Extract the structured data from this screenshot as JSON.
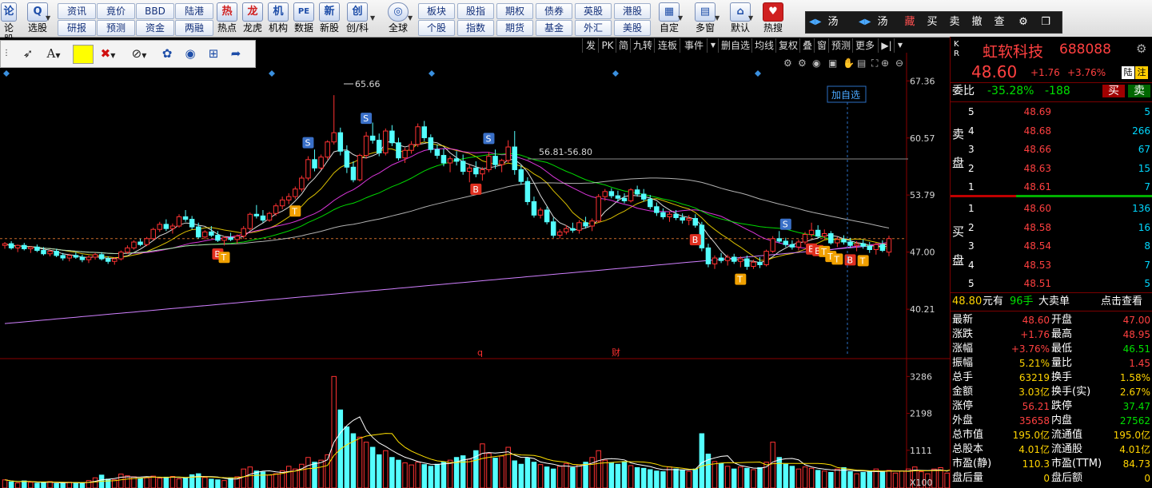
{
  "toolbar": {
    "left_labels": [
      "论股",
      "选股"
    ],
    "grid_buttons": [
      [
        "资讯",
        "竟价",
        "BBD",
        "陆港"
      ],
      [
        "研报",
        "预测",
        "资金",
        "两融"
      ]
    ],
    "icon_buttons": [
      {
        "icon": "热",
        "label": "热点",
        "name": "hotspot"
      },
      {
        "icon": "龙",
        "label": "龙虎",
        "name": "dragon-tiger"
      },
      {
        "icon": "机",
        "label": "机构",
        "name": "institution"
      },
      {
        "icon": "PE",
        "label": "数据",
        "name": "data"
      },
      {
        "icon": "新",
        "label": "新股",
        "name": "new-stock"
      },
      {
        "icon": "创",
        "label": "创/科",
        "name": "gem-star"
      },
      {
        "icon": "◎",
        "label": "全球",
        "name": "global"
      }
    ],
    "grid_buttons2": [
      [
        "板块",
        "股指",
        "期权",
        "债券",
        "英股",
        "港股"
      ],
      [
        "个股",
        "指数",
        "期货",
        "基金",
        "外汇",
        "美股"
      ]
    ],
    "right_icons": [
      {
        "icon": "▦",
        "label": "自定",
        "name": "custom"
      },
      {
        "icon": "▤",
        "label": "多窗",
        "name": "multi-window"
      },
      {
        "icon": "⌂",
        "label": "默认",
        "name": "default"
      },
      {
        "icon": "♥",
        "label": "热搜",
        "name": "hot-search"
      }
    ],
    "trade": {
      "items": [
        "汤",
        "汤",
        "藏",
        "买",
        "卖",
        "撤",
        "查"
      ]
    }
  },
  "chart_tabs": [
    "发",
    "PK",
    "简",
    "九转",
    "连板",
    "事件",
    "删自选",
    "均线",
    "复权",
    "叠",
    "窗",
    "预测",
    "更多"
  ],
  "chart_annotations": {
    "high_label": "65.66",
    "range_label": "56.81-56.80",
    "add_watch": "加自选",
    "marker_q": "q",
    "marker_cai": "财"
  },
  "stock": {
    "name": "虹软科技",
    "code": "688088",
    "price": "48.60",
    "change": "+1.76",
    "change_pct": "+3.76%",
    "tag_lu": "陆",
    "tag_zhu": "注",
    "kr": "K R"
  },
  "weibi": {
    "label": "委比",
    "pct": "-35.28%",
    "diff": "-188",
    "buy_btn": "买",
    "sell_btn": "卖"
  },
  "order_book": {
    "sell_label": [
      "卖",
      "盘"
    ],
    "buy_label": [
      "买",
      "盘"
    ],
    "asks": [
      {
        "level": "5",
        "price": "48.69",
        "vol": "5"
      },
      {
        "level": "4",
        "price": "48.68",
        "vol": "266"
      },
      {
        "level": "3",
        "price": "48.66",
        "vol": "67"
      },
      {
        "level": "2",
        "price": "48.63",
        "vol": "15"
      },
      {
        "level": "1",
        "price": "48.61",
        "vol": "7"
      }
    ],
    "bids": [
      {
        "level": "1",
        "price": "48.60",
        "vol": "136"
      },
      {
        "level": "2",
        "price": "48.58",
        "vol": "16"
      },
      {
        "level": "3",
        "price": "48.54",
        "vol": "8"
      },
      {
        "level": "4",
        "price": "48.53",
        "vol": "7"
      },
      {
        "level": "5",
        "price": "48.51",
        "vol": "5"
      }
    ]
  },
  "big_order": {
    "price": "48.80",
    "unit": "元有",
    "count": "96手",
    "label": "大卖单",
    "link": "点击查看"
  },
  "stats": [
    {
      "l1": "最新",
      "v1": "48.60",
      "c1": "red",
      "l2": "开盘",
      "v2": "47.00",
      "c2": "red"
    },
    {
      "l1": "涨跌",
      "v1": "+1.76",
      "c1": "red",
      "l2": "最高",
      "v2": "48.95",
      "c2": "red"
    },
    {
      "l1": "涨幅",
      "v1": "+3.76%",
      "c1": "red",
      "l2": "最低",
      "v2": "46.51",
      "c2": "green"
    },
    {
      "l1": "振幅",
      "v1": "5.21%",
      "c1": "yellow",
      "l2": "量比",
      "v2": "1.45",
      "c2": "red"
    },
    {
      "l1": "总手",
      "v1": "63219",
      "c1": "yellow",
      "l2": "换手",
      "v2": "1.58%",
      "c2": "yellow"
    },
    {
      "l1": "金额",
      "v1": "3.03亿",
      "c1": "yellow",
      "l2": "换手(实)",
      "v2": "2.67%",
      "c2": "yellow"
    },
    {
      "l1": "涨停",
      "v1": "56.21",
      "c1": "red",
      "l2": "跌停",
      "v2": "37.47",
      "c2": "green"
    },
    {
      "l1": "外盘",
      "v1": "35658",
      "c1": "red",
      "l2": "内盘",
      "v2": "27562",
      "c2": "green"
    },
    {
      "l1": "总市值",
      "v1": "195.0亿",
      "c1": "yellow",
      "l2": "流通值",
      "v2": "195.0亿",
      "c2": "yellow"
    },
    {
      "l1": "总股本",
      "v1": "4.01亿",
      "c1": "yellow",
      "l2": "流通股",
      "v2": "4.01亿",
      "c2": "yellow"
    },
    {
      "l1": "市盈(静)",
      "v1": "110.3",
      "c1": "yellow",
      "l2": "市盈(TTM)",
      "v2": "84.73",
      "c2": "yellow"
    },
    {
      "l1": "盘后量",
      "v1": "0",
      "c1": "yellow",
      "l2": "盘后额",
      "v2": "0",
      "c2": "yellow"
    }
  ],
  "chart_data": {
    "type": "candlestick",
    "price_ticks": [
      67.36,
      60.57,
      53.79,
      47.0,
      40.21
    ],
    "price_range": [
      35.0,
      69.0
    ],
    "volume_ticks": [
      3286,
      2198,
      1111
    ],
    "volume_range": [
      0,
      3600
    ],
    "volume_unit": "X100",
    "reference_price": 48.6,
    "candles": [
      [
        47.8,
        48.2,
        47.4,
        48.0
      ],
      [
        48.0,
        48.3,
        47.3,
        47.5
      ],
      [
        47.5,
        47.9,
        47.0,
        47.8
      ],
      [
        47.8,
        48.1,
        47.2,
        47.4
      ],
      [
        47.4,
        47.7,
        46.9,
        47.6
      ],
      [
        47.6,
        47.9,
        47.0,
        47.2
      ],
      [
        47.2,
        47.6,
        46.6,
        46.8
      ],
      [
        46.8,
        47.3,
        46.5,
        47.1
      ],
      [
        47.1,
        47.4,
        46.4,
        46.6
      ],
      [
        46.6,
        46.9,
        46.0,
        46.3
      ],
      [
        46.3,
        46.8,
        45.9,
        46.6
      ],
      [
        46.6,
        47.0,
        46.2,
        46.4
      ],
      [
        46.4,
        46.7,
        45.8,
        46.1
      ],
      [
        46.1,
        46.6,
        45.7,
        46.4
      ],
      [
        46.4,
        46.9,
        46.1,
        46.7
      ],
      [
        46.7,
        47.0,
        46.0,
        46.2
      ],
      [
        46.2,
        46.5,
        45.6,
        45.9
      ],
      [
        45.9,
        46.4,
        45.5,
        46.2
      ],
      [
        46.2,
        47.2,
        46.0,
        47.0
      ],
      [
        47.0,
        47.8,
        46.8,
        47.5
      ],
      [
        47.5,
        48.4,
        47.3,
        48.2
      ],
      [
        48.2,
        48.6,
        47.7,
        47.9
      ],
      [
        47.9,
        48.8,
        47.7,
        48.6
      ],
      [
        48.6,
        49.9,
        48.4,
        49.7
      ],
      [
        49.7,
        50.6,
        49.4,
        50.3
      ],
      [
        50.3,
        50.9,
        49.5,
        49.8
      ],
      [
        49.8,
        50.4,
        49.2,
        50.1
      ],
      [
        50.1,
        51.5,
        49.9,
        51.2
      ],
      [
        51.2,
        52.0,
        50.6,
        50.9
      ],
      [
        50.9,
        51.3,
        49.7,
        50.0
      ],
      [
        50.0,
        50.5,
        48.6,
        48.8
      ],
      [
        48.8,
        49.6,
        48.5,
        49.4
      ],
      [
        49.4,
        50.1,
        48.8,
        49.0
      ],
      [
        49.0,
        49.5,
        48.2,
        48.4
      ],
      [
        48.4,
        48.9,
        47.8,
        48.7
      ],
      [
        48.7,
        49.3,
        48.3,
        48.5
      ],
      [
        48.5,
        49.1,
        48.0,
        48.9
      ],
      [
        48.9,
        50.1,
        48.6,
        49.8
      ],
      [
        49.8,
        51.7,
        49.6,
        51.5
      ],
      [
        51.5,
        52.6,
        51.0,
        51.3
      ],
      [
        51.3,
        52.0,
        50.5,
        50.8
      ],
      [
        50.8,
        51.8,
        50.6,
        51.6
      ],
      [
        51.6,
        52.8,
        51.3,
        52.5
      ],
      [
        52.5,
        53.6,
        52.1,
        53.2
      ],
      [
        53.2,
        54.0,
        52.7,
        53.6
      ],
      [
        53.6,
        54.8,
        53.3,
        54.5
      ],
      [
        54.5,
        56.1,
        54.2,
        55.8
      ],
      [
        55.8,
        58.4,
        55.5,
        58.0
      ],
      [
        58.0,
        59.2,
        56.6,
        57.0
      ],
      [
        57.0,
        58.6,
        56.8,
        58.3
      ],
      [
        58.3,
        60.3,
        58.0,
        60.1
      ],
      [
        60.1,
        65.66,
        59.8,
        61.2
      ],
      [
        61.2,
        61.8,
        58.5,
        59.0
      ],
      [
        59.0,
        59.7,
        56.4,
        57.1
      ],
      [
        57.1,
        57.8,
        55.3,
        55.6
      ],
      [
        55.6,
        58.7,
        55.4,
        58.5
      ],
      [
        58.5,
        61.3,
        58.1,
        60.8
      ],
      [
        60.8,
        62.4,
        59.9,
        60.3
      ],
      [
        60.3,
        61.1,
        58.4,
        58.8
      ],
      [
        58.8,
        61.7,
        58.5,
        61.4
      ],
      [
        61.4,
        62.1,
        59.6,
        60.0
      ],
      [
        60.0,
        60.6,
        57.9,
        58.2
      ],
      [
        58.2,
        59.4,
        57.6,
        59.1
      ],
      [
        59.1,
        60.2,
        58.7,
        59.8
      ],
      [
        59.8,
        62.3,
        59.5,
        61.9
      ],
      [
        61.9,
        62.6,
        60.2,
        60.6
      ],
      [
        60.6,
        61.0,
        58.8,
        59.2
      ],
      [
        59.2,
        59.8,
        58.1,
        58.5
      ],
      [
        58.5,
        59.3,
        57.2,
        57.6
      ],
      [
        57.6,
        58.4,
        56.5,
        58.1
      ],
      [
        58.1,
        59.0,
        57.3,
        57.8
      ],
      [
        57.8,
        58.6,
        56.2,
        56.6
      ],
      [
        56.6,
        57.4,
        55.3,
        57.0
      ],
      [
        57.0,
        57.8,
        55.9,
        56.3
      ],
      [
        56.3,
        57.1,
        55.5,
        56.8
      ],
      [
        56.8,
        58.9,
        56.5,
        58.4
      ],
      [
        58.4,
        59.2,
        56.9,
        57.4
      ],
      [
        57.4,
        58.1,
        56.5,
        57.9
      ],
      [
        57.9,
        60.3,
        57.6,
        59.5
      ],
      [
        59.5,
        61.4,
        56.2,
        56.8
      ],
      [
        56.8,
        57.3,
        55.0,
        55.4
      ],
      [
        55.4,
        55.9,
        52.6,
        53.0
      ],
      [
        53.0,
        53.6,
        51.1,
        51.4
      ],
      [
        51.4,
        52.3,
        51.0,
        52.0
      ],
      [
        52.0,
        52.4,
        50.3,
        50.6
      ],
      [
        50.6,
        51.1,
        48.7,
        49.0
      ],
      [
        49.0,
        49.7,
        48.6,
        49.4
      ],
      [
        49.4,
        50.2,
        49.1,
        49.8
      ],
      [
        49.8,
        50.5,
        49.3,
        49.6
      ],
      [
        49.6,
        50.8,
        49.2,
        50.5
      ],
      [
        50.5,
        51.2,
        49.8,
        50.1
      ],
      [
        50.1,
        51.0,
        49.5,
        50.7
      ],
      [
        50.7,
        53.9,
        50.5,
        53.6
      ],
      [
        53.6,
        54.5,
        53.1,
        54.2
      ],
      [
        54.2,
        54.6,
        53.4,
        53.7
      ],
      [
        53.7,
        54.3,
        53.0,
        53.4
      ],
      [
        53.4,
        54.0,
        52.8,
        53.1
      ],
      [
        53.1,
        54.6,
        52.9,
        54.4
      ],
      [
        54.4,
        54.9,
        53.6,
        53.9
      ],
      [
        53.9,
        54.5,
        53.0,
        53.3
      ],
      [
        53.3,
        53.8,
        52.1,
        52.4
      ],
      [
        52.4,
        52.9,
        51.3,
        51.7
      ],
      [
        51.7,
        52.2,
        50.9,
        51.2
      ],
      [
        51.2,
        51.8,
        50.6,
        51.5
      ],
      [
        51.5,
        52.0,
        50.8,
        51.1
      ],
      [
        51.1,
        51.6,
        50.4,
        50.8
      ],
      [
        50.8,
        51.4,
        50.2,
        51.0
      ],
      [
        51.0,
        51.5,
        49.9,
        50.2
      ],
      [
        50.2,
        50.6,
        47.1,
        47.5
      ],
      [
        47.5,
        48.0,
        45.2,
        45.6
      ],
      [
        45.6,
        46.6,
        45.0,
        46.3
      ],
      [
        46.3,
        46.9,
        45.7,
        46.0
      ],
      [
        46.0,
        46.7,
        45.4,
        46.4
      ],
      [
        46.4,
        46.8,
        45.6,
        45.9
      ],
      [
        45.9,
        46.5,
        45.2,
        46.2
      ],
      [
        46.2,
        46.6,
        44.9,
        45.3
      ],
      [
        45.3,
        46.1,
        45.0,
        45.8
      ],
      [
        45.8,
        46.4,
        45.1,
        45.5
      ],
      [
        45.5,
        47.3,
        45.3,
        47.1
      ],
      [
        47.1,
        48.9,
        46.9,
        48.6
      ],
      [
        48.6,
        49.5,
        48.1,
        48.3
      ],
      [
        48.3,
        48.7,
        47.6,
        47.9
      ],
      [
        47.9,
        48.4,
        47.3,
        47.6
      ],
      [
        47.6,
        48.5,
        47.2,
        48.2
      ],
      [
        48.2,
        49.4,
        47.9,
        49.1
      ],
      [
        49.1,
        50.5,
        48.8,
        49.6
      ],
      [
        49.6,
        50.2,
        48.6,
        48.9
      ],
      [
        48.9,
        49.7,
        48.5,
        49.2
      ],
      [
        49.2,
        49.5,
        47.9,
        48.1
      ],
      [
        48.1,
        48.8,
        47.6,
        48.5
      ],
      [
        48.5,
        49.0,
        47.9,
        48.2
      ],
      [
        48.2,
        48.7,
        47.5,
        47.8
      ],
      [
        47.8,
        48.3,
        47.1,
        48.0
      ],
      [
        48.0,
        48.5,
        47.4,
        47.7
      ],
      [
        47.7,
        48.2,
        46.9,
        47.3
      ],
      [
        47.3,
        48.1,
        46.7,
        47.9
      ],
      [
        47.9,
        48.4,
        47.0,
        47.2
      ],
      [
        47.0,
        48.95,
        46.51,
        48.6
      ]
    ],
    "volumes": [
      240,
      180,
      150,
      210,
      170,
      140,
      160,
      190,
      130,
      150,
      170,
      160,
      140,
      220,
      300,
      380,
      260,
      240,
      410,
      360,
      330,
      280,
      300,
      350,
      290,
      320,
      340,
      270,
      300,
      390,
      420,
      310,
      260,
      240,
      220,
      280,
      330,
      560,
      620,
      500,
      470,
      380,
      420,
      510,
      640,
      560,
      700,
      900,
      760,
      820,
      980,
      3286,
      2300,
      1800,
      1600,
      1500,
      1350,
      1200,
      980,
      1100,
      900,
      820,
      740,
      680,
      760,
      690,
      640,
      700,
      760,
      820,
      900,
      950,
      850,
      1100,
      1300,
      1020,
      880,
      940,
      1200,
      800,
      700,
      880,
      760,
      690,
      620,
      560,
      640,
      720,
      600,
      680,
      760,
      900,
      1100,
      820,
      740,
      700,
      780,
      660,
      600,
      580,
      540,
      500,
      480,
      620,
      560,
      520,
      490,
      560,
      1600,
      1000,
      780,
      720,
      640,
      560,
      620,
      580,
      540,
      600,
      760,
      1350,
      900,
      700,
      640,
      560,
      620,
      580,
      520,
      500,
      460,
      560,
      600,
      480,
      420,
      460,
      500,
      560,
      480,
      520,
      440,
      500,
      560,
      620,
      480,
      420,
      560,
      600,
      440,
      860
    ]
  }
}
